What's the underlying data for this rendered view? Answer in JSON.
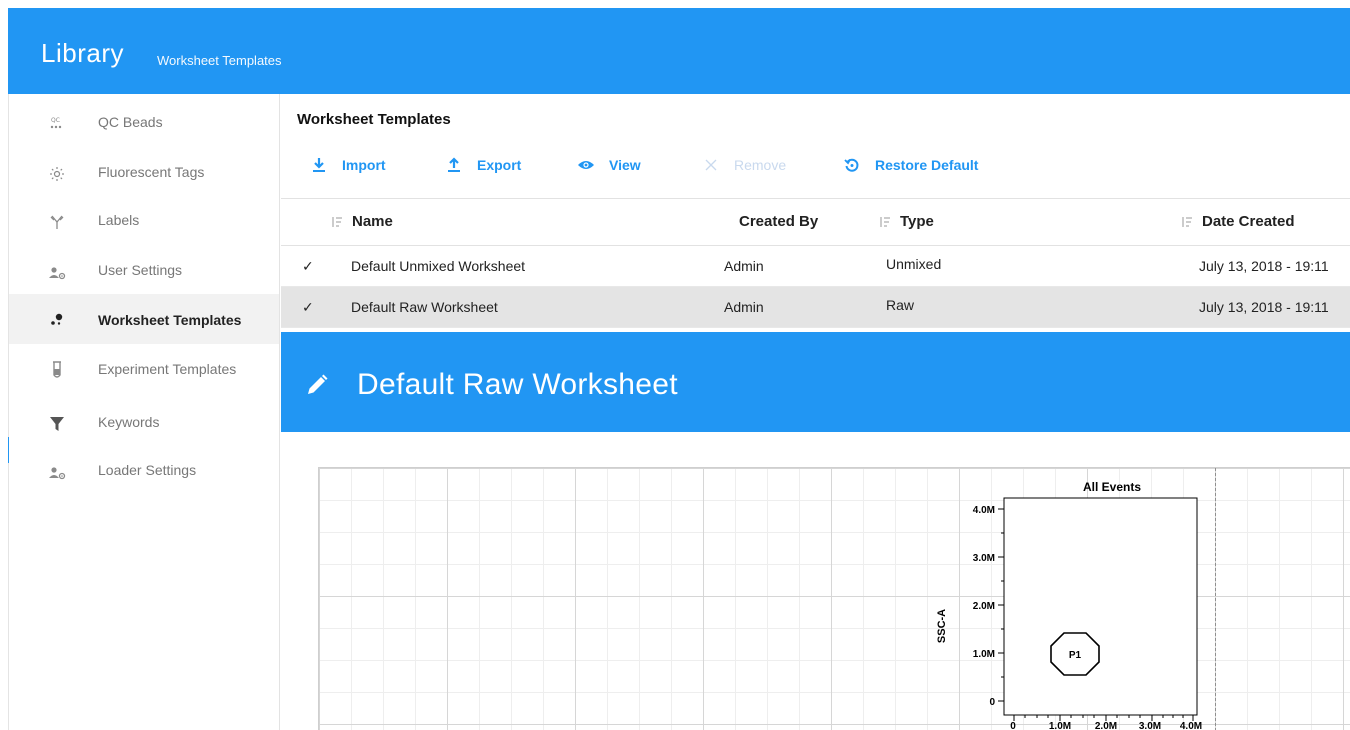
{
  "header": {
    "title": "Library",
    "subtitle": "Worksheet Templates"
  },
  "sidebar": {
    "items": [
      {
        "label": "QC Beads",
        "icon": "qc-beads-icon",
        "active": false
      },
      {
        "label": "Fluorescent Tags",
        "icon": "fluorescent-icon",
        "active": false
      },
      {
        "label": "Labels",
        "icon": "antibody-icon",
        "active": false
      },
      {
        "label": "User Settings",
        "icon": "user-settings-icon",
        "active": false
      },
      {
        "label": "Worksheet Templates",
        "icon": "worksheet-dots-icon",
        "active": true
      },
      {
        "label": "Experiment Templates",
        "icon": "test-tube-icon",
        "active": false
      },
      {
        "label": "Keywords",
        "icon": "funnel-icon",
        "active": false
      },
      {
        "label": "Loader Settings",
        "icon": "user-settings-icon",
        "active": false
      }
    ]
  },
  "main": {
    "title": "Worksheet Templates",
    "toolbar": {
      "import": "Import",
      "export": "Export",
      "view": "View",
      "remove": "Remove",
      "restore": "Restore Default"
    },
    "table": {
      "columns": {
        "name": "Name",
        "created_by": "Created By",
        "type": "Type",
        "date_created": "Date Created"
      },
      "rows": [
        {
          "check": "✓",
          "name": "Default Unmixed Worksheet",
          "created_by": "Admin",
          "type": "Unmixed",
          "date": "July 13, 2018 - 19:11"
        },
        {
          "check": "✓",
          "name": "Default Raw Worksheet",
          "created_by": "Admin",
          "type": "Raw",
          "date": "July 13, 2018 - 19:11"
        }
      ]
    },
    "detail": {
      "title": "Default Raw Worksheet"
    },
    "plot": {
      "title": "All Events",
      "ylabel": "SSC-A",
      "gate_label": "P1",
      "y_ticks": [
        "4.0M",
        "3.0M",
        "2.0M",
        "1.0M",
        "0"
      ],
      "x_ticks": [
        "0",
        "1.0M",
        "2.0M",
        "3.0M",
        "4.0M"
      ]
    }
  },
  "colors": {
    "accent": "#2196f3",
    "selected_row": "#e4e4e4"
  }
}
